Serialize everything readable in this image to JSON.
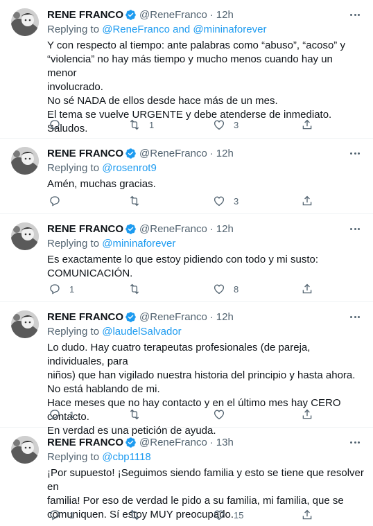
{
  "tweets": [
    {
      "name": "RENE FRANCO",
      "handle": "@ReneFranco",
      "time": "12h",
      "replying_prefix": "Replying to",
      "replying_to": "@ReneFranco and @mininaforever",
      "lines": [
        "Y con respecto al tiempo: ante palabras como “abuso”, “acoso” y",
        "“violencia” no hay más tiempo y mucho menos cuando hay un menor",
        "involucrado.",
        "No sé NADA de ellos desde hace más de un mes.",
        "El tema se vuelve URGENTE y debe atenderse de inmediato.",
        "Saludos."
      ],
      "reply_count": "",
      "retweet_count": "1",
      "like_count": "3"
    },
    {
      "name": "RENE FRANCO",
      "handle": "@ReneFranco",
      "time": "12h",
      "replying_prefix": "Replying to",
      "replying_to": "@rosenrot9",
      "lines": [
        "Amén, muchas gracias."
      ],
      "reply_count": "",
      "retweet_count": "",
      "like_count": "3"
    },
    {
      "name": "RENE FRANCO",
      "handle": "@ReneFranco",
      "time": "12h",
      "replying_prefix": "Replying to",
      "replying_to": "@mininaforever",
      "lines": [
        "Es exactamente lo que estoy pidiendo con todo y mi susto:",
        "COMUNICACIÓN."
      ],
      "reply_count": "1",
      "retweet_count": "",
      "like_count": "8"
    },
    {
      "name": "RENE FRANCO",
      "handle": "@ReneFranco",
      "time": "12h",
      "replying_prefix": "Replying to",
      "replying_to": "@laudelSalvador",
      "lines": [
        "Lo dudo. Hay cuatro terapeutas profesionales (de pareja, individuales, para",
        "niños) que han vigilado nuestra historia del principio y hasta ahora.",
        "No está hablando de mi.",
        "Hace meses que no hay contacto y en el último mes hay CERO contacto.",
        "En verdad es una petición de ayuda."
      ],
      "reply_count": "1",
      "retweet_count": "",
      "like_count": ""
    },
    {
      "name": "RENE FRANCO",
      "handle": "@ReneFranco",
      "time": "13h",
      "replying_prefix": "Replying to",
      "replying_to": "@cbp1118",
      "lines": [
        "¡Por supuesto! ¡Seguimos siendo familia y esto se tiene que resolver en",
        "familia! Por eso de verdad le pido a su familia, mi familia, que se",
        "comuniquen. Sí estoy MUY preocupado."
      ],
      "reply_count": "1",
      "retweet_count": "",
      "like_count": "15"
    }
  ],
  "colors": {
    "text": "#0f1419",
    "secondary": "#536471",
    "link": "#1d9bf0",
    "verified": "#1d9bf0",
    "divider": "#eff3f4"
  },
  "icons": {
    "verified": "verified-badge-icon",
    "more": "more-dots-icon",
    "reply": "reply-icon",
    "retweet": "retweet-icon",
    "like": "heart-icon",
    "share": "share-icon"
  }
}
